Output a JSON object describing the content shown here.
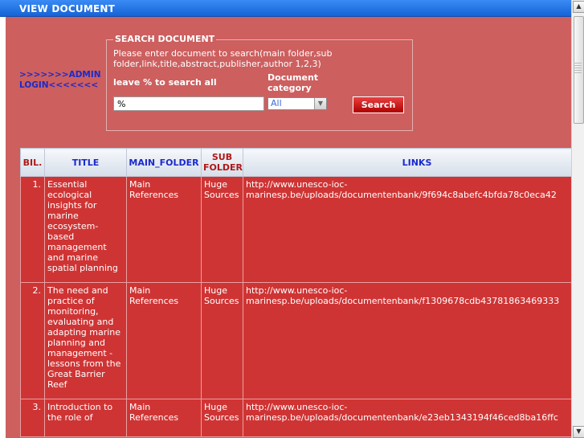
{
  "header": {
    "title": "VIEW DOCUMENT"
  },
  "admin_link": {
    "label": ">>>>>>>ADMIN LOGIN<<<<<<<"
  },
  "search": {
    "legend": "SEARCH DOCUMENT",
    "help": "Please enter document to search(main folder,sub folder,link,title,abstract,publisher,author 1,2,3)",
    "leave_label": "leave % to search all",
    "value": "%",
    "category_label": "Document category",
    "category_selected": "All",
    "button_label": "Search"
  },
  "table": {
    "headers": [
      "BIL.",
      "TITLE",
      "MAIN_FOLDER",
      "SUB FOLDER",
      "LINKS"
    ],
    "rows": [
      {
        "num": "1.",
        "title": "Essential ecological insights for marine ecosystem-based management and marine spatial planning",
        "main_folder": "Main References",
        "sub_folder": "Huge Sources",
        "link": "http://www.unesco-ioc-marinesp.be/uploads/documentenbank/9f694c8abefc4bfda78c0eca42"
      },
      {
        "num": "2.",
        "title": "The need and practice of monitoring, evaluating and adapting marine planning and management - lessons from the Great Barrier Reef",
        "main_folder": "Main References",
        "sub_folder": "Huge Sources",
        "link": "http://www.unesco-ioc-marinesp.be/uploads/documentenbank/f1309678cdb43781863469333"
      },
      {
        "num": "3.",
        "title": "Introduction to the role of",
        "main_folder": "Main References",
        "sub_folder": "Huge Sources",
        "link": "http://www.unesco-ioc-marinesp.be/uploads/documentenbank/e23eb1343194f46ced8ba16ffc"
      }
    ]
  },
  "colors": {
    "header_blue": "#1f6fe6",
    "panel_red": "#cd5f5f",
    "row_red": "#cf3434"
  }
}
